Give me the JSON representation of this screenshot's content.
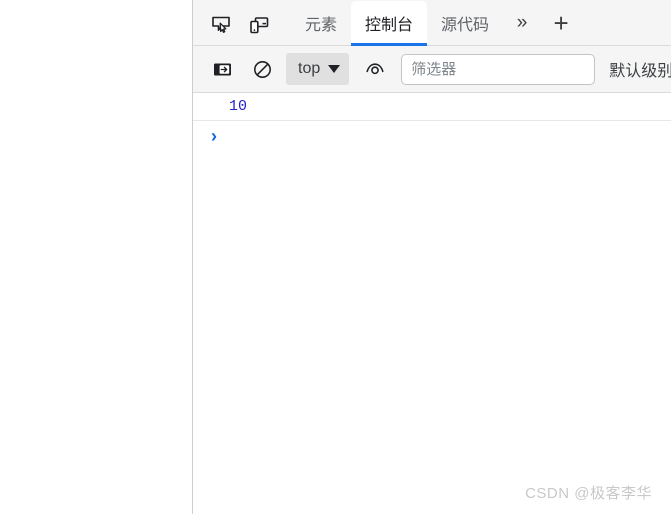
{
  "devtools": {
    "tabbar": {
      "inspect_icon": "inspect-element-icon",
      "device_icon": "device-toolbar-icon",
      "tabs": [
        {
          "label": "元素",
          "active": false
        },
        {
          "label": "控制台",
          "active": true
        },
        {
          "label": "源代码",
          "active": false
        }
      ],
      "more_tabs": "»",
      "new_tab": "+",
      "active_underline_color": "#1a73e8"
    },
    "toolbar": {
      "sidebar_toggle_icon": "console-sidebar-icon",
      "clear_console_icon": "clear-console-icon",
      "context_selector": {
        "value": "top",
        "caret_icon": "chevron-down-icon"
      },
      "live_expression_icon": "eye-icon",
      "filter": {
        "value": "",
        "placeholder": "筛选器"
      },
      "levels_label": "默认级别"
    },
    "console": {
      "rows": [
        {
          "type": "result",
          "value": "10",
          "color": "#2323c8"
        }
      ],
      "prompt": {
        "caret": "›",
        "value": ""
      }
    }
  },
  "watermark": {
    "text": "CSDN @极客李华"
  }
}
